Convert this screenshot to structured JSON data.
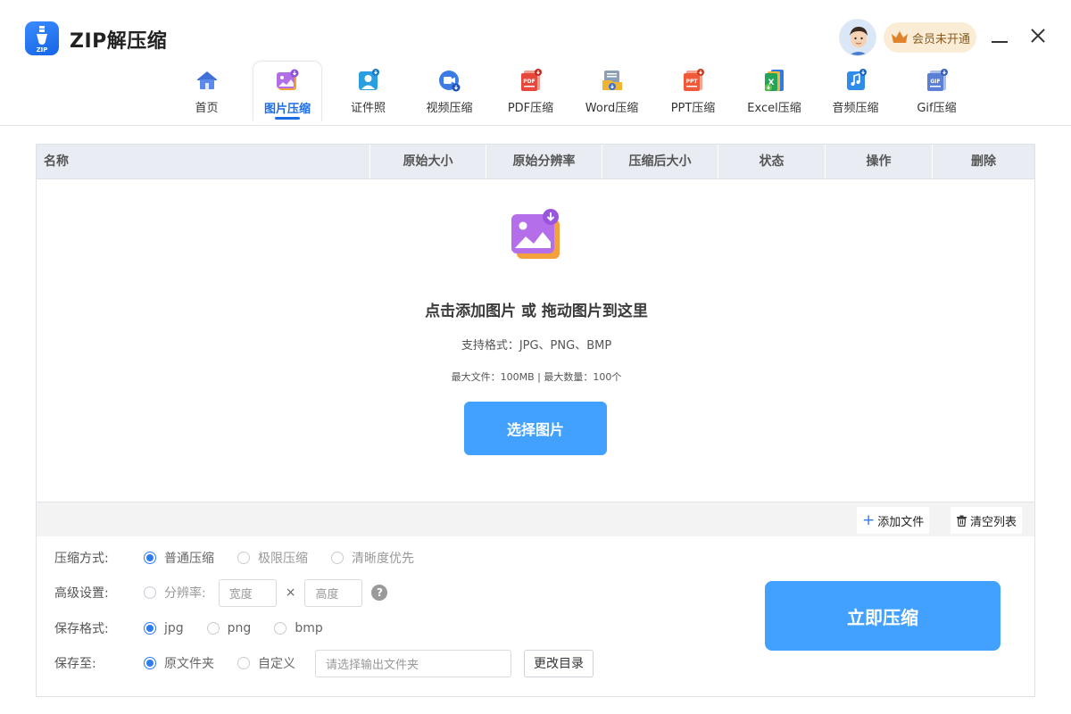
{
  "app": {
    "title": "ZIP解压缩",
    "logo_text": "ZIP"
  },
  "account": {
    "vip_label": "会员未开通"
  },
  "colors": {
    "accent": "#1a6de5",
    "button": "#42a1ff",
    "vip_bg": "#fbecd6"
  },
  "nav": [
    {
      "label": "首页",
      "icon": "home-icon"
    },
    {
      "label": "图片压缩",
      "icon": "image-compress-icon",
      "active": true
    },
    {
      "label": "证件照",
      "icon": "id-photo-icon"
    },
    {
      "label": "视频压缩",
      "icon": "video-compress-icon"
    },
    {
      "label": "PDF压缩",
      "icon": "pdf-compress-icon"
    },
    {
      "label": "Word压缩",
      "icon": "word-compress-icon"
    },
    {
      "label": "PPT压缩",
      "icon": "ppt-compress-icon"
    },
    {
      "label": "Excel压缩",
      "icon": "excel-compress-icon"
    },
    {
      "label": "音频压缩",
      "icon": "audio-compress-icon"
    },
    {
      "label": "Gif压缩",
      "icon": "gif-compress-icon"
    }
  ],
  "table": {
    "columns": [
      "名称",
      "原始大小",
      "原始分辨率",
      "压缩后大小",
      "状态",
      "操作",
      "删除"
    ]
  },
  "dropzone": {
    "title": "点击添加图片 或 拖动图片到这里",
    "formats": "支持格式：JPG、PNG、BMP",
    "limits": "最大文件：100MB | 最大数量：100个",
    "select_button": "选择图片"
  },
  "toolbar": {
    "add_file": "添加文件",
    "clear_list": "清空列表"
  },
  "settings": {
    "mode": {
      "label": "压缩方式:",
      "options": [
        "普通压缩",
        "极限压缩",
        "清晰度优先"
      ],
      "selected": 0
    },
    "advanced": {
      "label": "高级设置:",
      "resolution_label": "分辨率:",
      "width_placeholder": "宽度",
      "times": "×",
      "height_placeholder": "高度",
      "help": "?"
    },
    "format": {
      "label": "保存格式:",
      "options": [
        "jpg",
        "png",
        "bmp"
      ],
      "selected": 0
    },
    "save_to": {
      "label": "保存至:",
      "options": [
        "原文件夹",
        "自定义"
      ],
      "selected": 0,
      "path_placeholder": "请选择输出文件夹",
      "change_button": "更改目录"
    }
  },
  "compress_button": "立即压缩"
}
